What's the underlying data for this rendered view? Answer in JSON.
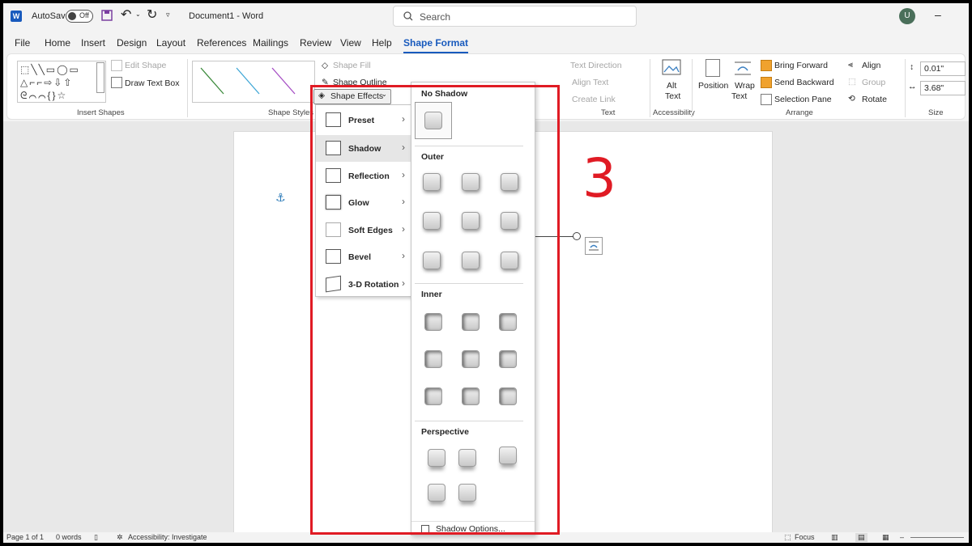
{
  "titlebar": {
    "app_letter": "W",
    "autosave_label": "AutoSave",
    "autosave_state": "Off",
    "doc_title": "Document1  -  Word",
    "search_placeholder": "Search",
    "user_initial": "U"
  },
  "menu": {
    "tabs": [
      "File",
      "Home",
      "Insert",
      "Design",
      "Layout",
      "References",
      "Mailings",
      "Review",
      "View",
      "Help",
      "Shape Format"
    ],
    "active_tab": "Shape Format"
  },
  "ribbon": {
    "insert_shapes": {
      "edit_shape": "Edit Shape",
      "draw_text_box": "Draw Text Box",
      "group_label": "Insert Shapes"
    },
    "shape_styles": {
      "shape_fill": "Shape Fill",
      "shape_outline": "Shape Outline",
      "shape_effects": "Shape Effects",
      "group_label": "Shape Styles"
    },
    "text": {
      "text_direction": "Text Direction",
      "align_text": "Align Text",
      "create_link": "Create Link",
      "group_label": "Text"
    },
    "accessibility": {
      "alt_text_line1": "Alt",
      "alt_text_line2": "Text",
      "group_label": "Accessibility"
    },
    "arrange": {
      "position": "Position",
      "wrap_text_line1": "Wrap",
      "wrap_text_line2": "Text",
      "bring_forward": "Bring Forward",
      "send_backward": "Send Backward",
      "selection_pane": "Selection Pane",
      "align": "Align",
      "group": "Group",
      "rotate": "Rotate",
      "group_label": "Arrange"
    },
    "size": {
      "height": "0.01\"",
      "width": "3.68\"",
      "group_label": "Size"
    }
  },
  "effects_menu": {
    "items": [
      {
        "label": "Preset"
      },
      {
        "label": "Shadow"
      },
      {
        "label": "Reflection"
      },
      {
        "label": "Glow"
      },
      {
        "label": "Soft Edges"
      },
      {
        "label": "Bevel"
      },
      {
        "label": "3-D Rotation"
      }
    ],
    "hovered": "Shadow"
  },
  "shadow_gallery": {
    "no_shadow": "No Shadow",
    "outer": "Outer",
    "inner": "Inner",
    "perspective": "Perspective",
    "shadow_options": "Shadow Options...",
    "outer_count": 9,
    "inner_count": 9,
    "perspective_count": 5
  },
  "annotation": {
    "step_number": "3",
    "color": "#e01b24"
  },
  "statusbar": {
    "page": "Page 1 of 1",
    "words": "0 words",
    "accessibility": "Accessibility: Investigate",
    "focus": "Focus"
  },
  "colors": {
    "accent": "#185abd",
    "highlight": "#e01b24"
  }
}
